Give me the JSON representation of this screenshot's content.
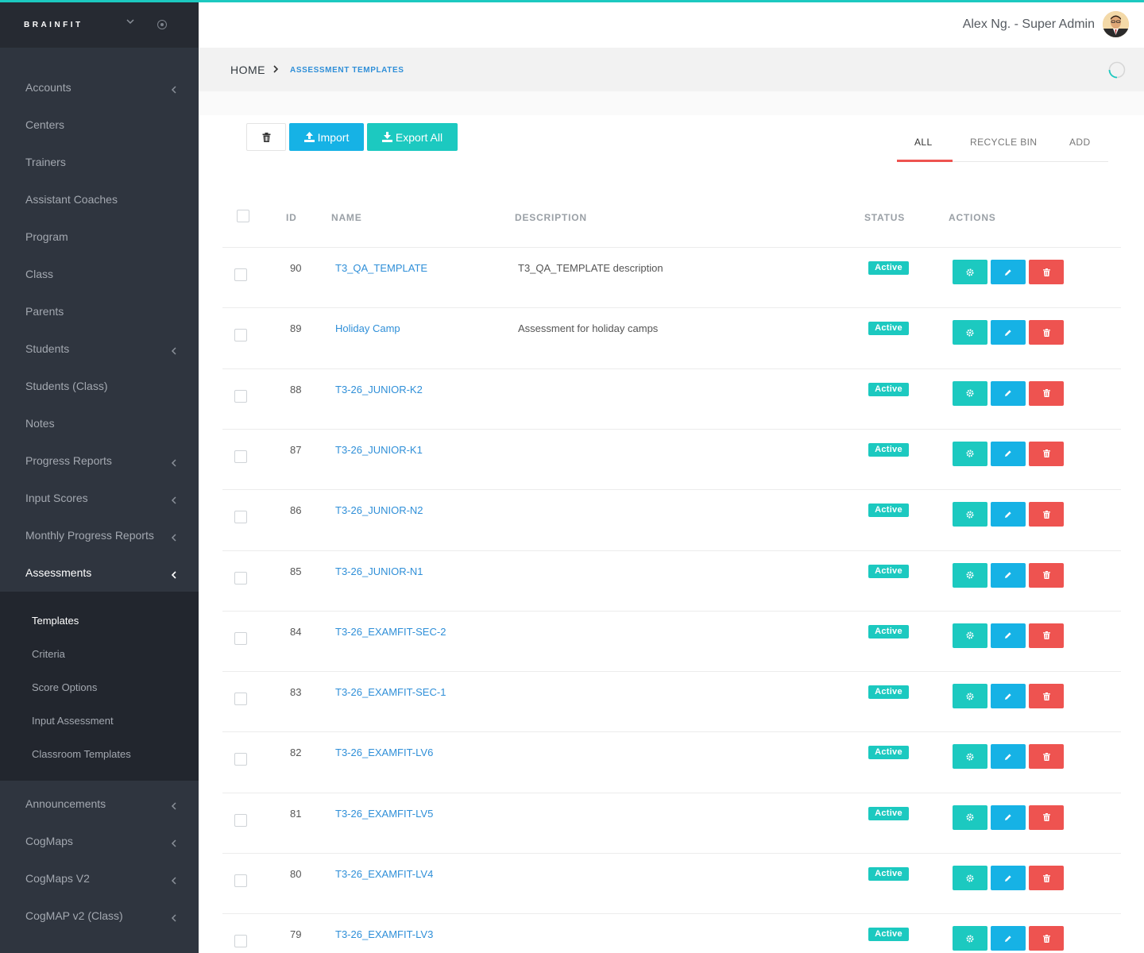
{
  "brand": "BRAINFIT",
  "user": {
    "name": "Alex Ng. - Super Admin"
  },
  "sidebar": {
    "items": [
      {
        "label": "Accounts",
        "chevron": true
      },
      {
        "label": "Centers",
        "chevron": false
      },
      {
        "label": "Trainers",
        "chevron": false
      },
      {
        "label": "Assistant Coaches",
        "chevron": false
      },
      {
        "label": "Program",
        "chevron": false
      },
      {
        "label": "Class",
        "chevron": false
      },
      {
        "label": "Parents",
        "chevron": false
      },
      {
        "label": "Students",
        "chevron": true
      },
      {
        "label": "Students (Class)",
        "chevron": false
      },
      {
        "label": "Notes",
        "chevron": false
      },
      {
        "label": "Progress Reports",
        "chevron": true
      },
      {
        "label": "Input Scores",
        "chevron": true
      },
      {
        "label": "Monthly Progress Reports",
        "chevron": true
      },
      {
        "label": "Assessments",
        "chevron": true,
        "active": true
      }
    ],
    "submenu": [
      "Templates",
      "Criteria",
      "Score Options",
      "Input Assessment",
      "Classroom Templates"
    ],
    "after": [
      {
        "label": "Announcements",
        "chevron": true
      },
      {
        "label": "CogMaps",
        "chevron": true
      },
      {
        "label": "CogMaps V2",
        "chevron": true
      },
      {
        "label": "CogMAP v2 (Class)",
        "chevron": true
      }
    ]
  },
  "breadcrumb": {
    "home": "HOME",
    "current": "ASSESSMENT TEMPLATES"
  },
  "toolbar": {
    "import_label": "Import",
    "export_label": "Export All"
  },
  "tabs": {
    "all": "ALL",
    "recycle": "RECYCLE BIN",
    "add": "ADD"
  },
  "table": {
    "headers": {
      "id": "ID",
      "name": "NAME",
      "description": "DESCRIPTION",
      "status": "STATUS",
      "actions": "ACTIONS"
    },
    "rows": [
      {
        "id": "90",
        "name": "T3_QA_TEMPLATE",
        "description": "T3_QA_TEMPLATE description",
        "status": "Active"
      },
      {
        "id": "89",
        "name": "Holiday Camp",
        "description": "Assessment for holiday camps",
        "status": "Active"
      },
      {
        "id": "88",
        "name": "T3-26_JUNIOR-K2",
        "description": "",
        "status": "Active"
      },
      {
        "id": "87",
        "name": "T3-26_JUNIOR-K1",
        "description": "",
        "status": "Active"
      },
      {
        "id": "86",
        "name": "T3-26_JUNIOR-N2",
        "description": "",
        "status": "Active"
      },
      {
        "id": "85",
        "name": "T3-26_JUNIOR-N1",
        "description": "",
        "status": "Active"
      },
      {
        "id": "84",
        "name": "T3-26_EXAMFIT-SEC-2",
        "description": "",
        "status": "Active"
      },
      {
        "id": "83",
        "name": "T3-26_EXAMFIT-SEC-1",
        "description": "",
        "status": "Active"
      },
      {
        "id": "82",
        "name": "T3-26_EXAMFIT-LV6",
        "description": "",
        "status": "Active"
      },
      {
        "id": "81",
        "name": "T3-26_EXAMFIT-LV5",
        "description": "",
        "status": "Active"
      },
      {
        "id": "80",
        "name": "T3-26_EXAMFIT-LV4",
        "description": "",
        "status": "Active"
      },
      {
        "id": "79",
        "name": "T3-26_EXAMFIT-LV3",
        "description": "",
        "status": "Active"
      }
    ]
  },
  "colors": {
    "teal": "#1cc9c0",
    "blue": "#16b2e5",
    "red": "#ee5350",
    "sidebar": "#2f353f"
  }
}
